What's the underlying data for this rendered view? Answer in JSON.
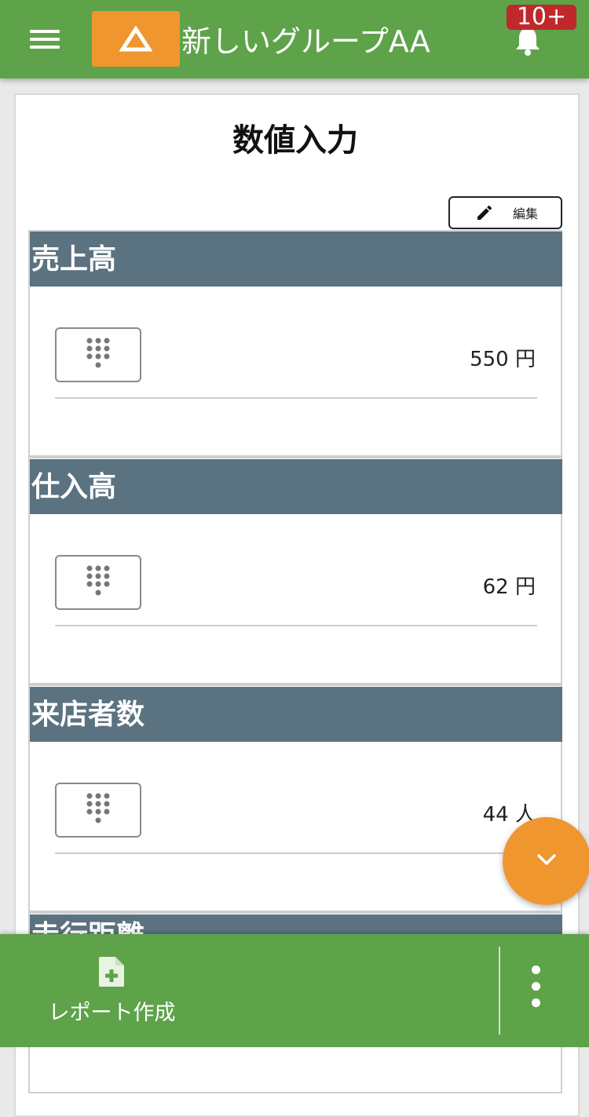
{
  "header": {
    "group_name": "新しいグループAA",
    "notification_badge": "10+",
    "colors": {
      "bar": "#5ea34a",
      "logo": "#f0962e",
      "badge": "#c0282c"
    }
  },
  "page": {
    "title": "数値入力",
    "edit_label": "編集"
  },
  "sections": [
    {
      "name": "売上高",
      "value": "550 円"
    },
    {
      "name": "仕入高",
      "value": "62 円"
    },
    {
      "name": "来店者数",
      "value": "44 人"
    },
    {
      "name": "走行距離"
    }
  ],
  "bottom_bar": {
    "report_label": "レポート作成"
  },
  "icons": [
    "menu-icon",
    "logo-triangle-icon",
    "bell-icon",
    "pencil-icon",
    "keypad-icon",
    "chevron-down-icon",
    "file-add-icon",
    "more-vertical-icon"
  ]
}
